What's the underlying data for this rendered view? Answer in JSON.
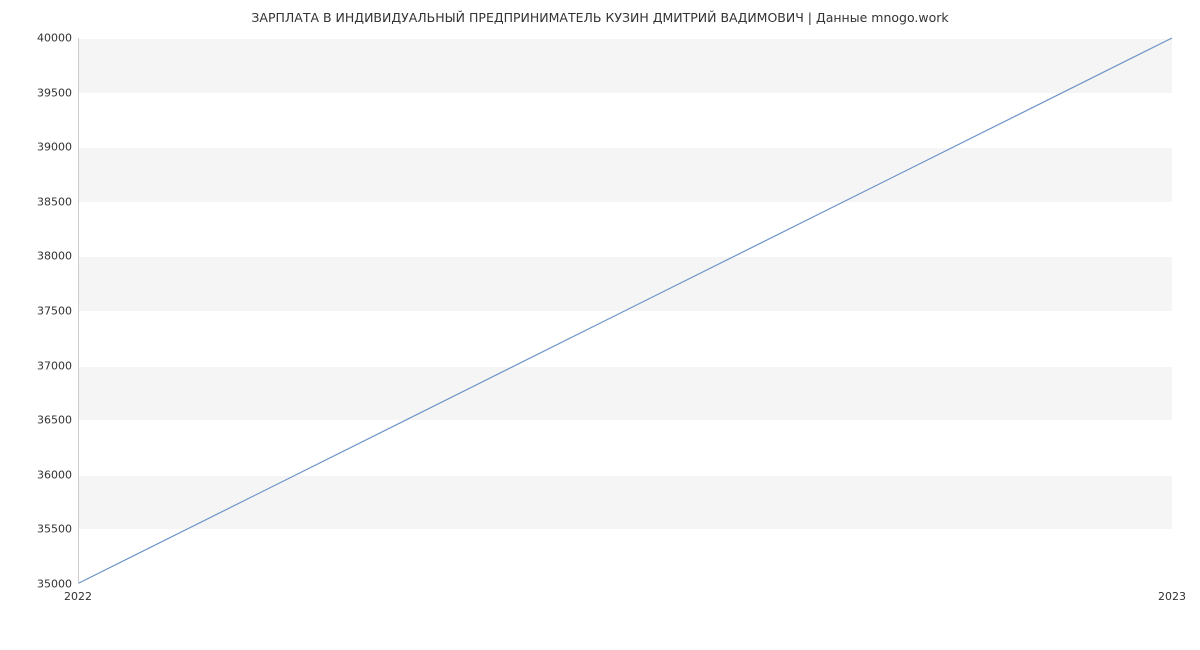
{
  "chart_data": {
    "type": "line",
    "title": "ЗАРПЛАТА В ИНДИВИДУАЛЬНЫЙ ПРЕДПРИНИМАТЕЛЬ КУЗИН ДМИТРИЙ ВАДИМОВИЧ | Данные mnogo.work",
    "x": [
      2022,
      2023
    ],
    "values": [
      35000,
      40000
    ],
    "x_ticks": [
      2022,
      2023
    ],
    "y_ticks": [
      35000,
      35500,
      36000,
      36500,
      37000,
      37500,
      38000,
      38500,
      39000,
      39500,
      40000
    ],
    "ylim": [
      35000,
      40000
    ],
    "xlim": [
      2022,
      2023
    ],
    "line_color": "#6d94c8",
    "xlabel": "",
    "ylabel": ""
  }
}
